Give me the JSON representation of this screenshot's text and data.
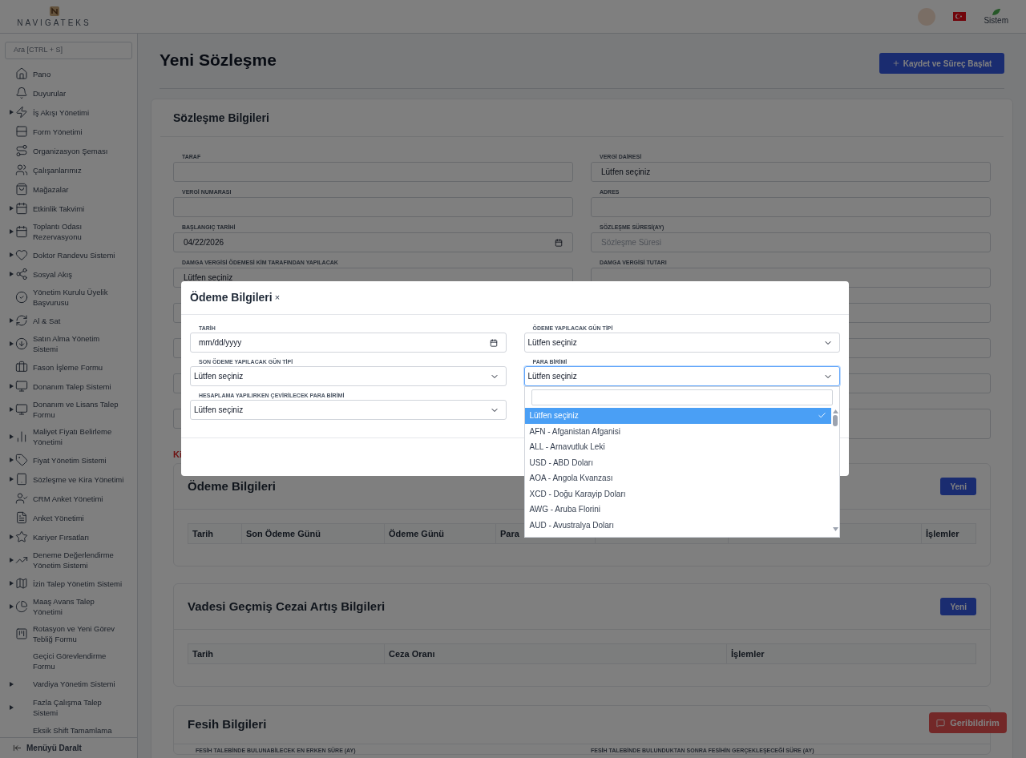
{
  "header": {
    "logo_text": "NAVIGATEKS",
    "user_menu": "Sistem"
  },
  "sidebar": {
    "search_placeholder": "Ara [CTRL + S]",
    "items": [
      {
        "label": "Pano",
        "expandable": false
      },
      {
        "label": "Duyurular",
        "expandable": false
      },
      {
        "label": "İş Akışı Yönetimi",
        "expandable": true
      },
      {
        "label": "Form Yönetimi",
        "expandable": false
      },
      {
        "label": "Organizasyon Şeması",
        "expandable": false
      },
      {
        "label": "Çalışanlarımız",
        "expandable": false
      },
      {
        "label": "Mağazalar",
        "expandable": false
      },
      {
        "label": "Etkinlik Takvimi",
        "expandable": true
      },
      {
        "label": "Toplantı Odası Rezervasyonu",
        "expandable": true
      },
      {
        "label": "Doktor Randevu Sistemi",
        "expandable": true
      },
      {
        "label": "Sosyal Akış",
        "expandable": true
      },
      {
        "label": "Yönetim Kurulu Üyelik Başvurusu",
        "expandable": false
      },
      {
        "label": "Al & Sat",
        "expandable": true
      },
      {
        "label": "Satın Alma Yönetim Sistemi",
        "expandable": true
      },
      {
        "label": "Fason İşleme Formu",
        "expandable": false
      },
      {
        "label": "Donanım Talep Sistemi",
        "expandable": true
      },
      {
        "label": "Donanım ve Lisans Talep Formu",
        "expandable": true
      },
      {
        "label": "Maliyet Fiyatı Belirleme Yönetimi",
        "expandable": true
      },
      {
        "label": "Fiyat Yönetim Sistemi",
        "expandable": true
      },
      {
        "label": "Sözleşme ve Kira Yönetimi",
        "expandable": true
      },
      {
        "label": "CRM Anket Yönetimi",
        "expandable": false
      },
      {
        "label": "Anket Yönetimi",
        "expandable": false
      },
      {
        "label": "Kariyer Fırsatları",
        "expandable": true
      },
      {
        "label": "Deneme Değerlendirme Yönetim Sistemi",
        "expandable": true
      },
      {
        "label": "İzin Talep Yönetim Sistemi",
        "expandable": true
      },
      {
        "label": "Maaş Avans Talep Yönetimi",
        "expandable": true
      },
      {
        "label": "Rotasyon ve Yeni Görev Tebliğ Formu",
        "expandable": false
      },
      {
        "label": "Geçici Görevlendirme Formu",
        "expandable": false
      },
      {
        "label": "Vardiya Yönetim Sistemi",
        "expandable": true
      },
      {
        "label": "Fazla Çalışma Talep Sistemi",
        "expandable": true
      },
      {
        "label": "Eksik Shift Tamamlama",
        "expandable": false
      }
    ],
    "collapse_label": "Menüyü Daralt"
  },
  "page": {
    "title": "Yeni Sözleşme",
    "primary_button": "Kaydet ve Süreç Başlat"
  },
  "contract_section": {
    "title": "Sözleşme Bilgileri",
    "fields": [
      {
        "label": "TARAF",
        "kind": "text"
      },
      {
        "label": "VERGİ DAİRESİ",
        "kind": "text",
        "value": "Lütfen seçiniz"
      },
      {
        "label": "VERGİ NUMARASI",
        "kind": "text"
      },
      {
        "label": "ADRES",
        "kind": "text"
      },
      {
        "label": "BAŞLANGIÇ TARİHİ",
        "kind": "date",
        "value": "04/22/2026"
      },
      {
        "label": "SÖZLEŞME SÜRESİ(AY)",
        "kind": "text",
        "placeholder": "Sözleşme Süresi"
      },
      {
        "label": "DAMGA VERGİSİ ÖDEMESİ KİM TARAFINDAN YAPILACAK",
        "kind": "text",
        "value": "Lütfen seçiniz"
      },
      {
        "label": "DAMGA VERGİSİ TUTARI",
        "kind": "text"
      }
    ],
    "covered_fields": [
      {
        "kind": "input"
      },
      {
        "kind": "input"
      },
      {
        "kind": "input"
      },
      {
        "kind": "input"
      },
      {
        "kind": "input"
      },
      {
        "kind": "input"
      },
      {
        "kind": "input"
      },
      {
        "kind": "textarea"
      }
    ],
    "error_text": "Ki"
  },
  "payment_section": {
    "title": "Ödeme Bilgileri",
    "new_button": "Yeni",
    "columns": [
      "Tarih",
      "Son Ödeme Günü",
      "Ödeme Günü",
      "Para",
      "İşlemler"
    ]
  },
  "penalty_section": {
    "title": "Vadesi Geçmiş Cezai Artış Bilgileri",
    "new_button": "Yeni",
    "columns": [
      "Tarih",
      "Ceza Oranı",
      "İşlemler"
    ]
  },
  "termination_section": {
    "title": "Fesih Bilgileri",
    "field_labels": [
      "FESİH TALEBİNDE BULUNABİLECEK EN ERKEN SÜRE (AY)",
      "FESİH TALEBİNDE BULUNDUKTAN SONRA FESİHİN GERÇEKLEŞECEĞİ SÜRE (AY)"
    ]
  },
  "feedback_button": "Geribildirim",
  "modal": {
    "title": "Ödeme Bilgileri",
    "close": "×",
    "fields": [
      {
        "label": "TARİH",
        "kind": "date",
        "placeholder": "mm/dd/yyyy"
      },
      {
        "label": "ÖDEME YAPILACAK GÜN TİPİ",
        "kind": "select",
        "value": "Lütfen seçiniz",
        "open": false
      },
      {
        "label": "SON ÖDEME YAPILACAK GÜN TİPİ",
        "kind": "select",
        "value": "Lütfen seçiniz",
        "open": false
      },
      {
        "label": "PARA BİRİMİ",
        "kind": "select",
        "value": "Lütfen seçiniz",
        "open": true
      },
      {
        "label": "HESAPLAMA YAPILIRKEN ÇEVİRİLECEK PARA BİRİMİ",
        "kind": "select",
        "value": "Lütfen seçiniz",
        "open": false
      }
    ],
    "dropdown_options": [
      {
        "label": "Lütfen seçiniz",
        "selected": true
      },
      {
        "label": "AFN - Afganistan Afganisi",
        "selected": false
      },
      {
        "label": "ALL - Arnavutluk Leki",
        "selected": false
      },
      {
        "label": "USD - ABD Doları",
        "selected": false
      },
      {
        "label": "AOA - Angola Kvanzası",
        "selected": false
      },
      {
        "label": "XCD - Doğu Karayip Doları",
        "selected": false
      },
      {
        "label": "AWG - Aruba Florini",
        "selected": false
      },
      {
        "label": "AUD - Avustralya Doları",
        "selected": false
      }
    ]
  }
}
